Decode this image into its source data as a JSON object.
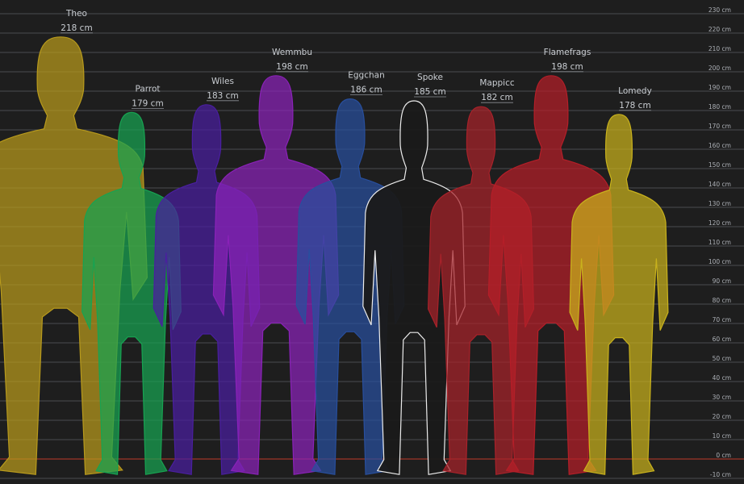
{
  "chart_data": {
    "type": "bar",
    "title": "",
    "xlabel": "",
    "ylabel": "",
    "unit": "cm",
    "ylim": [
      -10,
      230
    ],
    "ytick_step": 10,
    "grid": true,
    "ytick_labels": [
      "-10 cm",
      "0 cm",
      "10 cm",
      "20 cm",
      "30 cm",
      "40 cm",
      "50 cm",
      "60 cm",
      "70 cm",
      "80 cm",
      "90 cm",
      "100 cm",
      "110 cm",
      "120 cm",
      "130 cm",
      "140 cm",
      "150 cm",
      "160 cm",
      "170 cm",
      "180 cm",
      "190 cm",
      "200 cm",
      "210 cm",
      "220 cm",
      "230 cm"
    ],
    "categories": [
      "Theo",
      "Parrot",
      "Wiles",
      "Wemmbu",
      "Eggchan",
      "Spoke",
      "Mappicc",
      "Flamefrags",
      "Lomedy"
    ],
    "values": [
      218,
      179,
      183,
      198,
      186,
      185,
      182,
      198,
      178
    ],
    "height_labels": [
      "218 cm",
      "179 cm",
      "183 cm",
      "198 cm",
      "186 cm",
      "185 cm",
      "182 cm",
      "198 cm",
      "178 cm"
    ],
    "colors": [
      "#b89a1c",
      "#17a352",
      "#4a1fa0",
      "#8a22b8",
      "#284f9e",
      "#e8e8e8",
      "#a8222a",
      "#b51e28",
      "#c9b21c"
    ]
  }
}
